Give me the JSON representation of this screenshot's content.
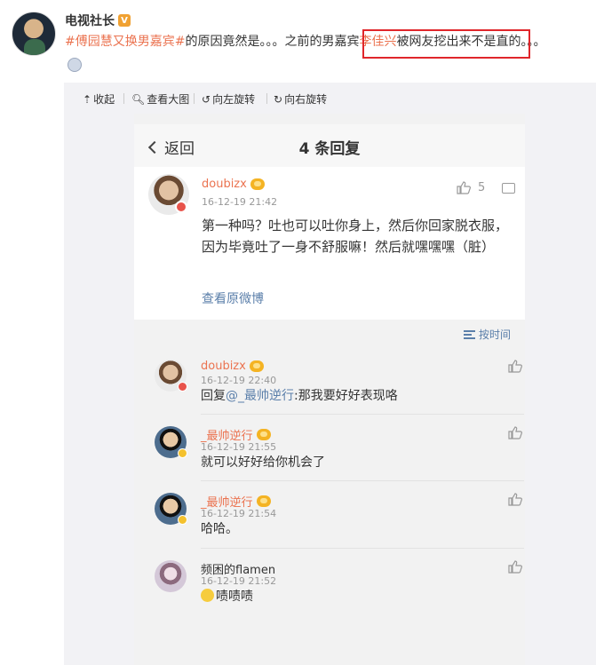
{
  "post": {
    "author": "电视社长",
    "verified_badge": "V",
    "text_tag": "#傅园慧又换男嘉宾#",
    "text_mid": "的原因竟然是。。。之前的男嘉宾",
    "text_mention": "李佳兴",
    "text_tail": "被网友挖出来不是直的。。。"
  },
  "toolbar": {
    "collapse": "收起",
    "view_large": "查看大图",
    "rotate_left": "向左旋转",
    "rotate_right": "向右旋转"
  },
  "screenshot": {
    "nav": {
      "back": "返回",
      "title": "4 条回复"
    },
    "main_comment": {
      "user": "doubizx",
      "time": "16-12-19 21:42",
      "likes": "5",
      "text": "第一种吗？吐也可以吐你身上，然后你回家脱衣服，因为毕竟吐了一身不舒服嘛！然后就嘿嘿嘿（脏）",
      "view_original": "查看原微博"
    },
    "sort_label": "按时间",
    "replies": [
      {
        "user": "doubizx",
        "time": "16-12-19 22:40",
        "text_prefix": "回复",
        "text_mention": "@_最帅逆行",
        "text_rest": ":那我要好好表现咯"
      },
      {
        "user": "_最帅逆行",
        "time": "16-12-19 21:55",
        "text": "就可以好好给你机会了"
      },
      {
        "user": "_最帅逆行",
        "time": "16-12-19 21:54",
        "text": "哈哈。"
      },
      {
        "user": "频困的flamen",
        "time": "16-12-19 21:52",
        "text": "啧啧啧"
      }
    ]
  },
  "colors": {
    "accent": "#eb7350",
    "link": "#5b7faa",
    "highlight_box": "#e0262b"
  }
}
